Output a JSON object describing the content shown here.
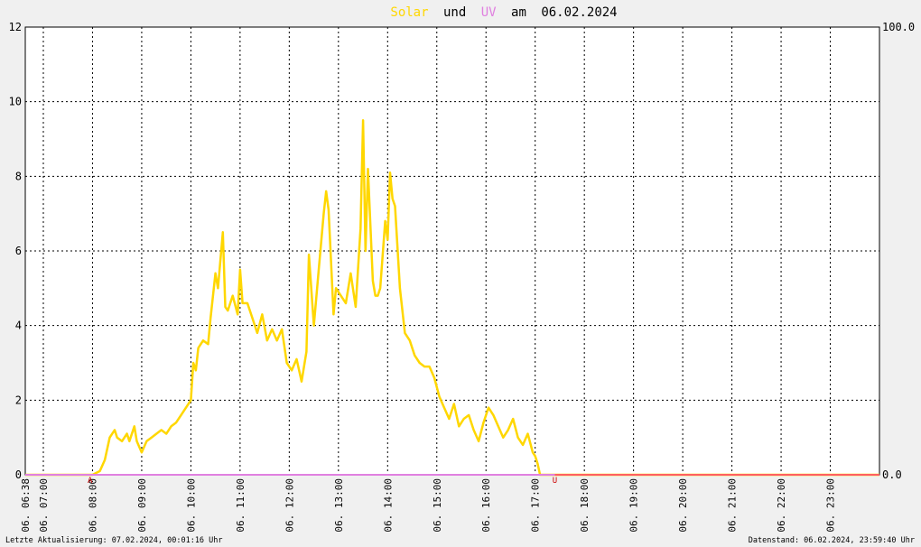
{
  "chart_data": {
    "type": "line",
    "title": {
      "solar": "Solar",
      "und": "und",
      "uv": "UV",
      "am": "am",
      "date": "06.02.2024"
    },
    "colors": {
      "solar": "#ffd700",
      "uv": "#e080e0",
      "title_text": "#000000",
      "sunrise_marker": "#cc0000",
      "sunset_line": "#ff6060",
      "grid": "#000000",
      "background": "#ffffff"
    },
    "y_left": {
      "range": [
        0,
        12
      ],
      "ticks": [
        "0",
        "2",
        "4",
        "6",
        "8",
        "10",
        "12"
      ]
    },
    "y_right": {
      "range": [
        0,
        100
      ],
      "ticks": [
        "0.0",
        "100.0"
      ]
    },
    "x_axis": {
      "range_hours": [
        6.633,
        24.0
      ],
      "tick_labels": [
        "06. 06:38",
        "06. 07:00",
        "06. 08:00",
        "06. 09:00",
        "06. 10:00",
        "06. 11:00",
        "06. 12:00",
        "06. 13:00",
        "06. 14:00",
        "06. 15:00",
        "06. 16:00",
        "06. 17:00",
        "06. 18:00",
        "06. 19:00",
        "06. 20:00",
        "06. 21:00",
        "06. 22:00",
        "06. 23:00"
      ],
      "tick_hours": [
        6.633,
        7,
        8,
        9,
        10,
        11,
        12,
        13,
        14,
        15,
        16,
        17,
        18,
        19,
        20,
        21,
        22,
        23
      ]
    },
    "grid": true,
    "markers": {
      "sunrise": {
        "label": "A",
        "hour": 7.95
      },
      "sunset": {
        "label": "U",
        "hour": 17.4
      }
    },
    "series": [
      {
        "name": "Solar",
        "x": [
          6.633,
          8.0,
          8.15,
          8.25,
          8.35,
          8.45,
          8.5,
          8.6,
          8.7,
          8.75,
          8.85,
          8.9,
          9.0,
          9.1,
          9.2,
          9.3,
          9.4,
          9.5,
          9.6,
          9.7,
          9.8,
          9.9,
          10.0,
          10.05,
          10.1,
          10.15,
          10.25,
          10.35,
          10.4,
          10.5,
          10.55,
          10.65,
          10.7,
          10.75,
          10.85,
          10.95,
          11.0,
          11.05,
          11.15,
          11.25,
          11.35,
          11.45,
          11.55,
          11.65,
          11.75,
          11.85,
          11.95,
          12.05,
          12.15,
          12.25,
          12.35,
          12.4,
          12.5,
          12.6,
          12.7,
          12.75,
          12.8,
          12.9,
          12.95,
          13.05,
          13.15,
          13.25,
          13.35,
          13.45,
          13.5,
          13.55,
          13.6,
          13.7,
          13.75,
          13.8,
          13.85,
          13.95,
          14.0,
          14.05,
          14.1,
          14.15,
          14.25,
          14.35,
          14.45,
          14.55,
          14.65,
          14.75,
          14.85,
          14.95,
          15.05,
          15.15,
          15.25,
          15.35,
          15.45,
          15.55,
          15.65,
          15.75,
          15.85,
          15.95,
          16.05,
          16.15,
          16.25,
          16.35,
          16.45,
          16.55,
          16.65,
          16.75,
          16.85,
          16.95,
          17.0,
          17.05,
          17.1,
          24.0
        ],
        "values": [
          0.0,
          0.0,
          0.1,
          0.4,
          1.0,
          1.2,
          1.0,
          0.9,
          1.1,
          0.9,
          1.3,
          0.9,
          0.6,
          0.9,
          1.0,
          1.1,
          1.2,
          1.1,
          1.3,
          1.4,
          1.6,
          1.8,
          2.0,
          3.0,
          2.8,
          3.4,
          3.6,
          3.5,
          4.2,
          5.4,
          5.0,
          6.5,
          4.5,
          4.4,
          4.8,
          4.3,
          5.5,
          4.6,
          4.6,
          4.2,
          3.8,
          4.3,
          3.6,
          3.9,
          3.6,
          3.9,
          3.0,
          2.8,
          3.1,
          2.5,
          3.3,
          5.9,
          4.0,
          5.5,
          7.0,
          7.6,
          7.1,
          4.3,
          5.0,
          4.8,
          4.6,
          5.4,
          4.5,
          6.6,
          9.5,
          6.0,
          8.2,
          5.2,
          4.8,
          4.8,
          5.0,
          6.8,
          6.3,
          8.1,
          7.4,
          7.2,
          5.0,
          3.8,
          3.6,
          3.2,
          3.0,
          2.9,
          2.9,
          2.6,
          2.1,
          1.8,
          1.5,
          1.9,
          1.3,
          1.5,
          1.6,
          1.2,
          0.9,
          1.4,
          1.8,
          1.6,
          1.3,
          1.0,
          1.2,
          1.5,
          1.0,
          0.8,
          1.1,
          0.6,
          0.5,
          0.3,
          0.0,
          0.0
        ]
      },
      {
        "name": "UV",
        "x": [
          6.633,
          24.0
        ],
        "values": [
          0.0,
          0.0
        ]
      }
    ]
  },
  "footer": {
    "last_update": "Letzte Aktualisierung: 07.02.2024, 00:01:16 Uhr",
    "data_status": "Datenstand: 06.02.2024, 23:59:40 Uhr"
  }
}
